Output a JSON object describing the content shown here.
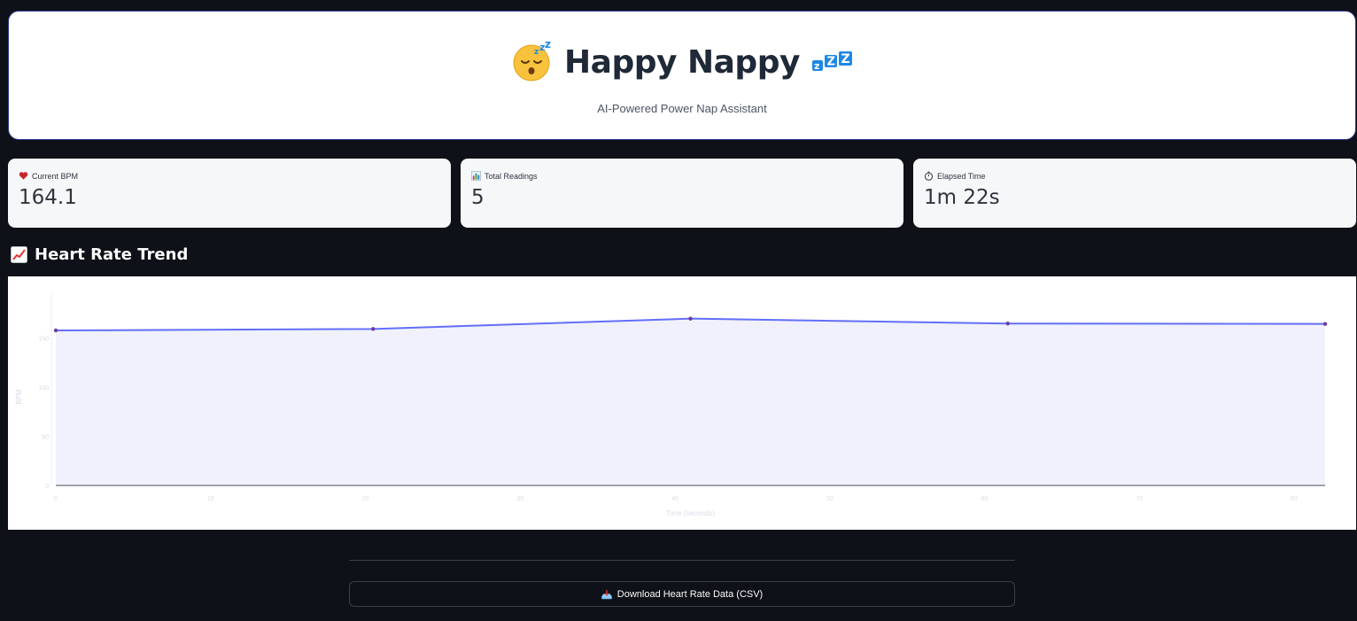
{
  "header": {
    "title": "Happy Nappy",
    "subtitle": "AI-Powered Power Nap Assistant",
    "leading_icon": "sleeping-face-icon",
    "trailing_icon": "zzz-icon"
  },
  "metrics": [
    {
      "icon": "heart-icon",
      "label": "Current BPM",
      "value": "164.1"
    },
    {
      "icon": "bar-chart-icon",
      "label": "Total Readings",
      "value": "5"
    },
    {
      "icon": "stopwatch-icon",
      "label": "Elapsed Time",
      "value": "1m 22s"
    }
  ],
  "section": {
    "icon": "chart-increasing-icon",
    "title": "Heart Rate Trend"
  },
  "chart_data": {
    "type": "area",
    "title": "",
    "xlabel": "Time (seconds)",
    "ylabel": "BPM",
    "x": [
      0,
      20.5,
      41,
      61.5,
      82
    ],
    "series": [
      {
        "values": [
          157.5,
          159,
          169.5,
          164.5,
          164.1
        ]
      }
    ],
    "xlim": [
      0,
      82
    ],
    "ylim": [
      0,
      180
    ],
    "x_ticks": [
      0,
      10,
      20,
      30,
      40,
      50,
      60,
      70,
      80
    ],
    "y_ticks": [
      0,
      50,
      100,
      150
    ],
    "grid": true,
    "line_color": "#636efa",
    "fill_color": "#eef0fc",
    "marker_color": "#6a3ea1"
  },
  "download": {
    "icon": "inbox-tray-icon",
    "label": "Download Heart Rate Data (CSV)"
  },
  "colors": {
    "background": "#0e1117",
    "card": "#f6f7f9",
    "header_border": "#2b3a8c"
  }
}
